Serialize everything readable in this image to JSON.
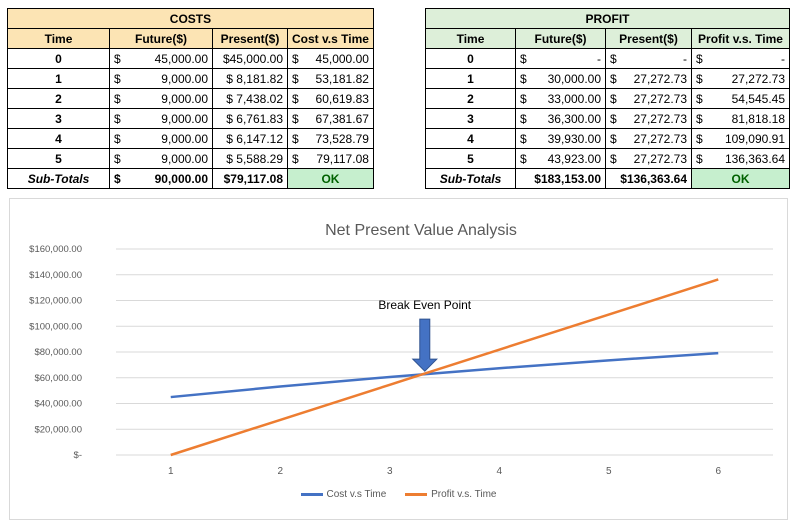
{
  "costs": {
    "title": "COSTS",
    "headers": [
      "Time",
      "Future($)",
      "Present($)",
      "Cost v.s Time"
    ],
    "rows": [
      {
        "time": "0",
        "future_cur": "$",
        "future": "45,000.00",
        "present": "$45,000.00",
        "cvt_cur": "$",
        "cvt": "45,000.00"
      },
      {
        "time": "1",
        "future_cur": "$",
        "future": "9,000.00",
        "present": "$ 8,181.82",
        "cvt_cur": "$",
        "cvt": "53,181.82"
      },
      {
        "time": "2",
        "future_cur": "$",
        "future": "9,000.00",
        "present": "$ 7,438.02",
        "cvt_cur": "$",
        "cvt": "60,619.83"
      },
      {
        "time": "3",
        "future_cur": "$",
        "future": "9,000.00",
        "present": "$ 6,761.83",
        "cvt_cur": "$",
        "cvt": "67,381.67"
      },
      {
        "time": "4",
        "future_cur": "$",
        "future": "9,000.00",
        "present": "$ 6,147.12",
        "cvt_cur": "$",
        "cvt": "73,528.79"
      },
      {
        "time": "5",
        "future_cur": "$",
        "future": "9,000.00",
        "present": "$ 5,588.29",
        "cvt_cur": "$",
        "cvt": "79,117.08"
      }
    ],
    "subtotal": {
      "label": "Sub-Totals",
      "future_cur": "$",
      "future": "90,000.00",
      "present": "$79,117.08",
      "status": "OK"
    }
  },
  "profit": {
    "title": "PROFIT",
    "headers": [
      "Time",
      "Future($)",
      "Present($)",
      "Profit v.s. Time"
    ],
    "rows": [
      {
        "time": "0",
        "future_cur": "$",
        "future": "-",
        "present_cur": "$",
        "present": "-",
        "pvt_cur": "$",
        "pvt": "-"
      },
      {
        "time": "1",
        "future_cur": "$",
        "future": "30,000.00",
        "present_cur": "$",
        "present": "27,272.73",
        "pvt_cur": "$",
        "pvt": "27,272.73"
      },
      {
        "time": "2",
        "future_cur": "$",
        "future": "33,000.00",
        "present_cur": "$",
        "present": "27,272.73",
        "pvt_cur": "$",
        "pvt": "54,545.45"
      },
      {
        "time": "3",
        "future_cur": "$",
        "future": "36,300.00",
        "present_cur": "$",
        "present": "27,272.73",
        "pvt_cur": "$",
        "pvt": "81,818.18"
      },
      {
        "time": "4",
        "future_cur": "$",
        "future": "39,930.00",
        "present_cur": "$",
        "present": "27,272.73",
        "pvt_cur": "$",
        "pvt": "109,090.91"
      },
      {
        "time": "5",
        "future_cur": "$",
        "future": "43,923.00",
        "present_cur": "$",
        "present": "27,272.73",
        "pvt_cur": "$",
        "pvt": "136,363.64"
      }
    ],
    "subtotal": {
      "label": "Sub-Totals",
      "future": "$183,153.00",
      "present": "$136,363.64",
      "status": "OK"
    }
  },
  "colors": {
    "costs_header": "#FCE4B4",
    "profit_header": "#DDEFD9",
    "ok_fill": "#C6EFCE",
    "ok_text": "#006100",
    "cost_series": "#4472C4",
    "profit_series": "#ED7D31",
    "arrow": "#4472C4"
  },
  "chart_data": {
    "type": "line",
    "title": "Net Present Value Analysis",
    "xlabel": "",
    "ylabel": "",
    "x": [
      1,
      2,
      3,
      4,
      5,
      6
    ],
    "x_tick_labels": [
      "1",
      "2",
      "3",
      "4",
      "5",
      "6"
    ],
    "y_tick_labels": [
      "$-",
      "$20,000.00",
      "$40,000.00",
      "$60,000.00",
      "$80,000.00",
      "$100,000.00",
      "$120,000.00",
      "$140,000.00",
      "$160,000.00"
    ],
    "ylim": [
      0,
      160000
    ],
    "grid": true,
    "legend_position": "bottom",
    "series": [
      {
        "name": "Cost v.s Time",
        "values": [
          45000.0,
          53181.82,
          60619.83,
          67381.67,
          73528.79,
          79117.08
        ]
      },
      {
        "name": "Profit v.s. Time",
        "values": [
          0,
          27272.73,
          54545.45,
          81818.18,
          109090.91,
          136363.64
        ]
      }
    ],
    "annotation": {
      "text": "Break Even Point",
      "x": 3.32,
      "y": 62000
    }
  }
}
